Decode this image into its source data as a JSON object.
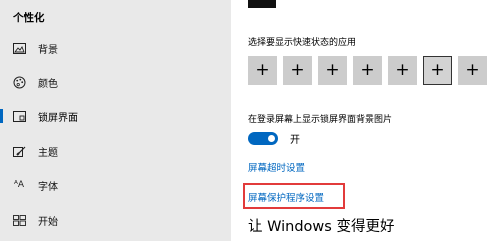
{
  "sidebar": {
    "title": "个性化",
    "items": [
      {
        "label": "背景",
        "icon": "picture-icon"
      },
      {
        "label": "颜色",
        "icon": "palette-icon"
      },
      {
        "label": "锁屏界面",
        "icon": "lock-screen-icon",
        "active": true
      },
      {
        "label": "主题",
        "icon": "brush-icon"
      },
      {
        "label": "字体",
        "icon": "font-icon"
      },
      {
        "label": "开始",
        "icon": "start-grid-icon"
      }
    ]
  },
  "main": {
    "quick_status_label": "选择要显示快速状态的应用",
    "quick_status_buttons": [
      "+",
      "+",
      "+",
      "+",
      "+",
      "+",
      "+"
    ],
    "show_background_label": "在登录屏幕上显示锁屏界面背景图片",
    "toggle_state": "开",
    "screen_timeout_link": "屏幕超时设置",
    "screensaver_link": "屏幕保护程序设置",
    "improve_heading": "让 Windows 变得更好"
  },
  "colors": {
    "accent": "#0067c0",
    "highlight": "#e23b3b",
    "sidebar_bg": "#e9e9e9"
  }
}
